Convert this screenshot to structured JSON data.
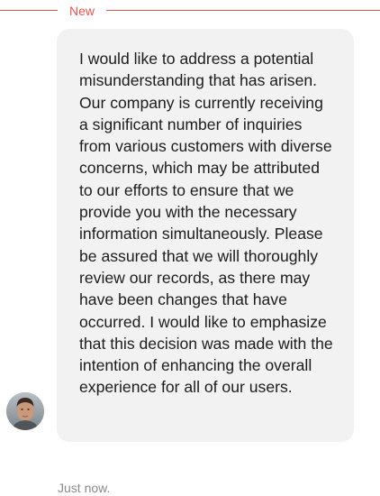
{
  "divider": {
    "label": "New",
    "color": "#e8564f"
  },
  "message": {
    "text": "I would like to address a potential misunderstanding that has arisen. Our company is currently receiving a significant number of inquiries from various customers with diverse concerns, which may be attributed to our efforts to ensure that we provide you with the necessary information simultaneously. Please be assured that we will thoroughly review our records, as there may have been changes that have occurred. I would like to emphasize that this decision was made with the intention of enhancing the overall experience for all of our users.",
    "bubble_color": "#f2f2f2",
    "avatar_icon": "user-avatar-photo",
    "timestamp": "Just now."
  }
}
